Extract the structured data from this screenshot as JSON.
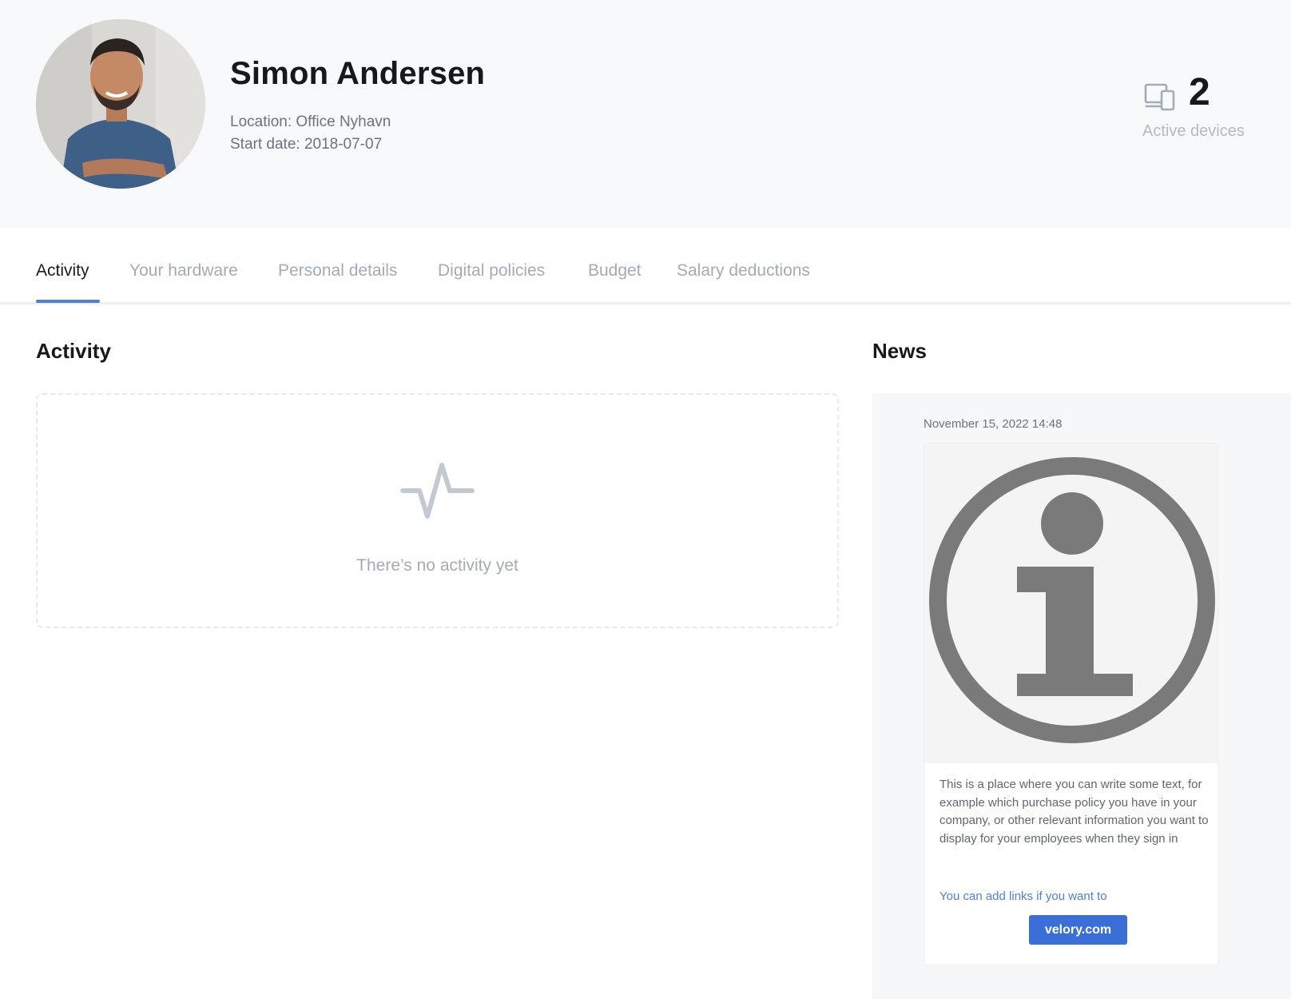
{
  "profile": {
    "name": "Simon Andersen",
    "location": "Location: Office Nyhavn",
    "start_date": "Start date: 2018-07-07",
    "avatar_icon": "user-photo"
  },
  "devices": {
    "count": "2",
    "label": "Active devices",
    "icon": "devices-icon"
  },
  "tabs": [
    {
      "label": "Activity",
      "active": true
    },
    {
      "label": "Your hardware",
      "active": false
    },
    {
      "label": "Personal details",
      "active": false
    },
    {
      "label": "Digital policies",
      "active": false
    },
    {
      "label": "Budget",
      "active": false
    },
    {
      "label": "Salary deductions",
      "active": false
    }
  ],
  "activity": {
    "title": "Activity",
    "empty_text": "There’s no activity yet",
    "icon": "pulse-icon"
  },
  "news": {
    "title": "News",
    "date": "November 15, 2022 14:48",
    "image_icon": "info-icon",
    "body": "This is a place where you can write some text, for example which purchase policy you have in your company, or other relevant information you want to display for your employees when they sign in",
    "link_text": "You can add links if you want to",
    "button_label": "velory.com"
  },
  "colors": {
    "accent": "#3b6fd8",
    "tab_underline": "#4f7de0",
    "muted_text": "#a3abb6",
    "header_bg": "#f8f9fb"
  }
}
